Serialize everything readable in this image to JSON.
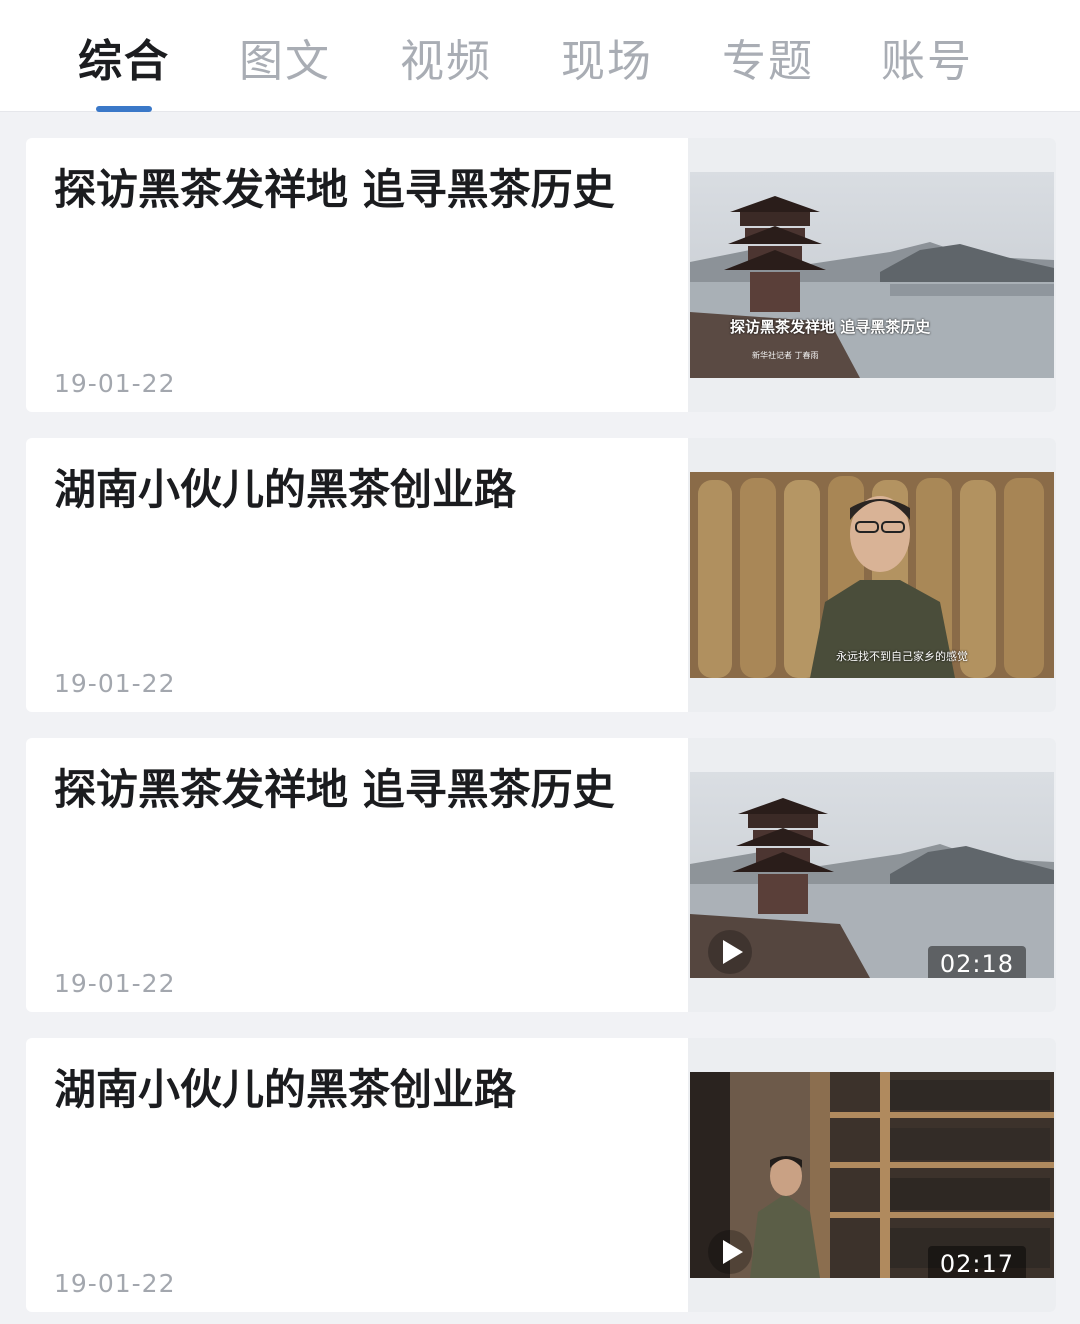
{
  "tabs": [
    {
      "label": "综合",
      "active": true
    },
    {
      "label": "图文",
      "active": false
    },
    {
      "label": "视频",
      "active": false
    },
    {
      "label": "现场",
      "active": false
    },
    {
      "label": "专题",
      "active": false
    },
    {
      "label": "账号",
      "active": false
    }
  ],
  "accent_color": "#3a78c8",
  "articles": [
    {
      "title": "探访黑茶发祥地 追寻黑茶历史",
      "date": "19-01-22",
      "thumb": "pagoda-lake-scene",
      "thumb_caption": "探访黑茶发祥地 追寻黑茶历史",
      "thumb_sub": "新华社记者 丁春雨",
      "duration": null
    },
    {
      "title": "湖南小伙儿的黑茶创业路",
      "date": "19-01-22",
      "thumb": "man-interview-tea-bundles",
      "thumb_subtitle": "永远找不到自己家乡的感觉",
      "duration": null
    },
    {
      "title": "探访黑茶发祥地 追寻黑茶历史",
      "date": "19-01-22",
      "thumb": "pagoda-lake-scene",
      "duration": "02:18"
    },
    {
      "title": "湖南小伙儿的黑茶创业路",
      "date": "19-01-22",
      "thumb": "man-in-tea-warehouse",
      "duration": "02:17"
    }
  ]
}
